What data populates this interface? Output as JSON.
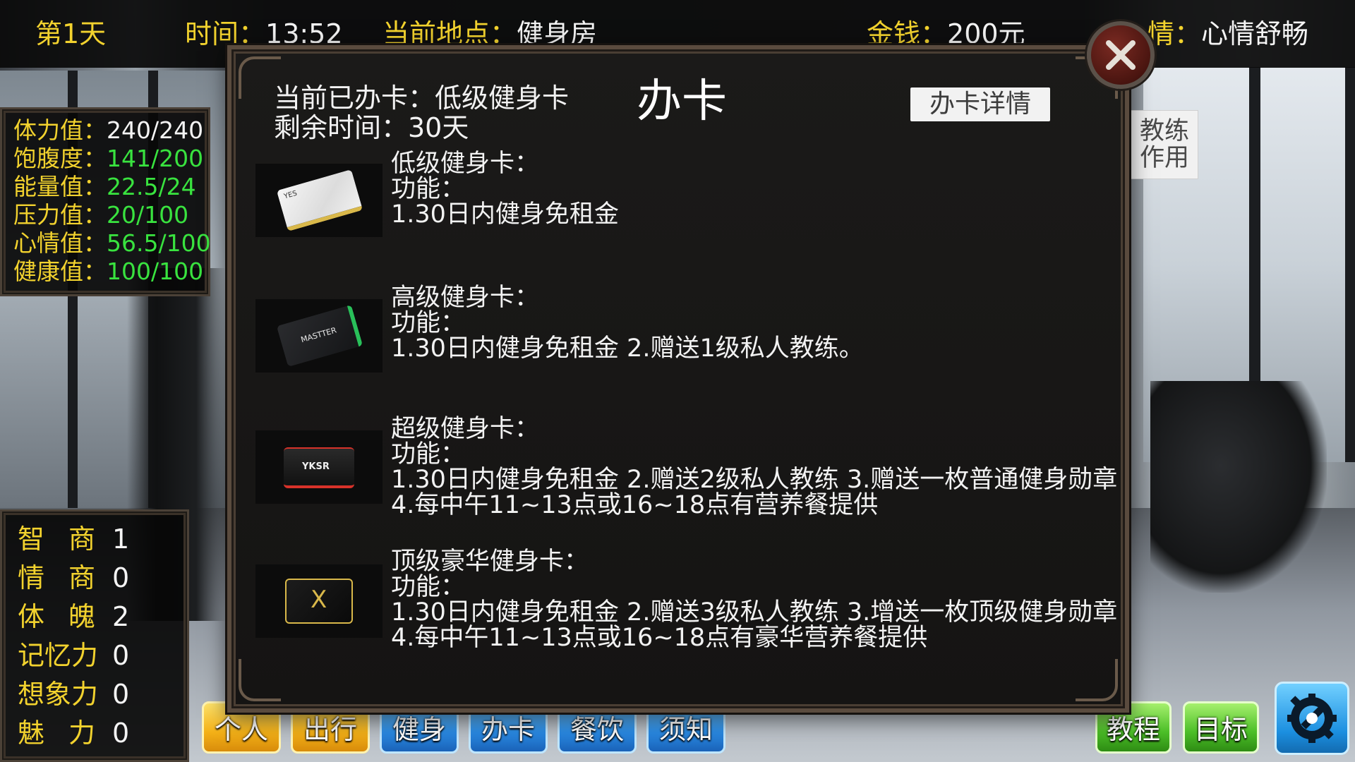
{
  "hud": {
    "day": "第1天",
    "time_label": "时间：",
    "time_value": "13:52",
    "location_label": "当前地点：",
    "location_value": "健身房",
    "money_label": "金钱：",
    "money_value": "200元",
    "mood_label": "情：",
    "mood_value": "心情舒畅"
  },
  "stats": [
    {
      "label": "体力值：",
      "value": "240/240",
      "color": "#f4f4f4"
    },
    {
      "label": "饱腹度：",
      "value": "141/200",
      "color": "#39e33f"
    },
    {
      "label": "能量值：",
      "value": "22.5/24",
      "color": "#39e33f"
    },
    {
      "label": "压力值：",
      "value": "20/100",
      "color": "#39e33f"
    },
    {
      "label": "心情值：",
      "value": "56.5/100",
      "color": "#39e33f"
    },
    {
      "label": "健康值：",
      "value": "100/100",
      "color": "#39e33f"
    }
  ],
  "attributes": [
    {
      "c1": "智",
      "c2": "商",
      "value": "1"
    },
    {
      "c1": "情",
      "c2": "商",
      "value": "0"
    },
    {
      "c1": "体",
      "c2": "魄",
      "value": "2"
    },
    {
      "c1": "记忆",
      "c2": "力",
      "value": "0"
    },
    {
      "c1": "想象",
      "c2": "力",
      "value": "0"
    },
    {
      "c1": "魅",
      "c2": "力",
      "value": "0"
    }
  ],
  "side_button": {
    "line1": "教练",
    "line2": "作用"
  },
  "modal": {
    "status_line1": "当前已办卡：低级健身卡",
    "status_line2": "剩余时间：30天",
    "title": "办卡",
    "detail_button": "办卡详情",
    "cards": [
      {
        "name": "低级健身卡：",
        "func_label": "功能：",
        "lines": [
          "1.30日内健身免租金"
        ],
        "card_text": "YES",
        "card_color": "#f0f0f0",
        "accent": "#d9b84a"
      },
      {
        "name": "高级健身卡：",
        "func_label": "功能：",
        "lines": [
          "1.30日内健身免租金 2.赠送1级私人教练。"
        ],
        "card_text": "MASTTER",
        "card_color": "#1e1f21",
        "accent": "#29c05a"
      },
      {
        "name": "超级健身卡：",
        "func_label": "功能：",
        "lines": [
          "1.30日内健身免租金 2.赠送2级私人教练 3.赠送一枚普通健身勋章",
          "4.每中午11~13点或16~18点有营养餐提供"
        ],
        "card_text": "YKSR",
        "card_color": "#1a1a1a",
        "accent": "#d8322a"
      },
      {
        "name": "顶级豪华健身卡：",
        "func_label": "功能：",
        "lines": [
          "1.30日内健身免租金 2.赠送3级私人教练 3.增送一枚顶级健身勋章",
          "4.每中午11~13点或16~18点有豪华营养餐提供"
        ],
        "card_text": "X",
        "card_color": "#121212",
        "accent": "#d9b84a"
      }
    ]
  },
  "tabs": [
    {
      "label": "个人",
      "style": "yellow"
    },
    {
      "label": "出行",
      "style": "yellow"
    },
    {
      "label": "健身",
      "style": "blue"
    },
    {
      "label": "办卡",
      "style": "blue"
    },
    {
      "label": "餐饮",
      "style": "blue"
    },
    {
      "label": "须知",
      "style": "blue"
    }
  ],
  "right_buttons": {
    "tutorial": "教程",
    "goal": "目标"
  },
  "icons": {
    "close": "close-icon",
    "settings": "gear-wrench-icon"
  }
}
